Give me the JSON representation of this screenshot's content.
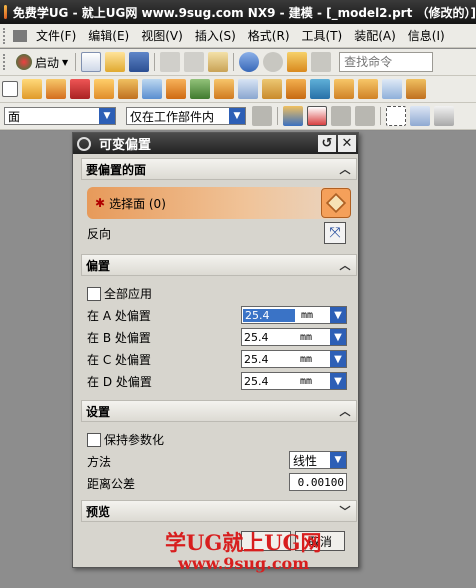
{
  "window": {
    "title": "免费学UG - 就上UG网 www.9sug.com   NX9 - 建模 - [_model2.prt （修改的）]"
  },
  "menubar": {
    "items": [
      "文件(F)",
      "编辑(E)",
      "视图(V)",
      "插入(S)",
      "格式(R)",
      "工具(T)",
      "装配(A)",
      "信息(I)"
    ]
  },
  "toolbar": {
    "start_label": "启动",
    "search_placeholder": "查找命令",
    "filter_type": "面",
    "filter_scope": "仅在工作部件内"
  },
  "dialog": {
    "title": "可变偏置",
    "face_section": {
      "header": "要偏置的面",
      "select_label": "选择面 (0)",
      "reverse_label": "反向"
    },
    "offset_section": {
      "header": "偏置",
      "apply_all_label": "全部应用",
      "rows": [
        {
          "label": "在 A 处偏置",
          "value": "25.4",
          "unit": "mm"
        },
        {
          "label": "在 B 处偏置",
          "value": "25.4",
          "unit": "mm"
        },
        {
          "label": "在 C 处偏置",
          "value": "25.4",
          "unit": "mm"
        },
        {
          "label": "在 D 处偏置",
          "value": "25.4",
          "unit": "mm"
        }
      ]
    },
    "settings_section": {
      "header": "设置",
      "keep_param_label": "保持参数化",
      "method_label": "方法",
      "method_value": "线性",
      "tolerance_label": "距离公差",
      "tolerance_value": "0.00100"
    },
    "preview_section": {
      "header": "预览"
    },
    "cancel_label": "取消"
  },
  "watermark": {
    "line1": "学UG就上UG网",
    "line2": "www.9sug.com"
  },
  "colors": {
    "accent_orange": "#e79a5a",
    "field_blue": "#2d5fb6",
    "watermark_red": "#d81e1e"
  }
}
